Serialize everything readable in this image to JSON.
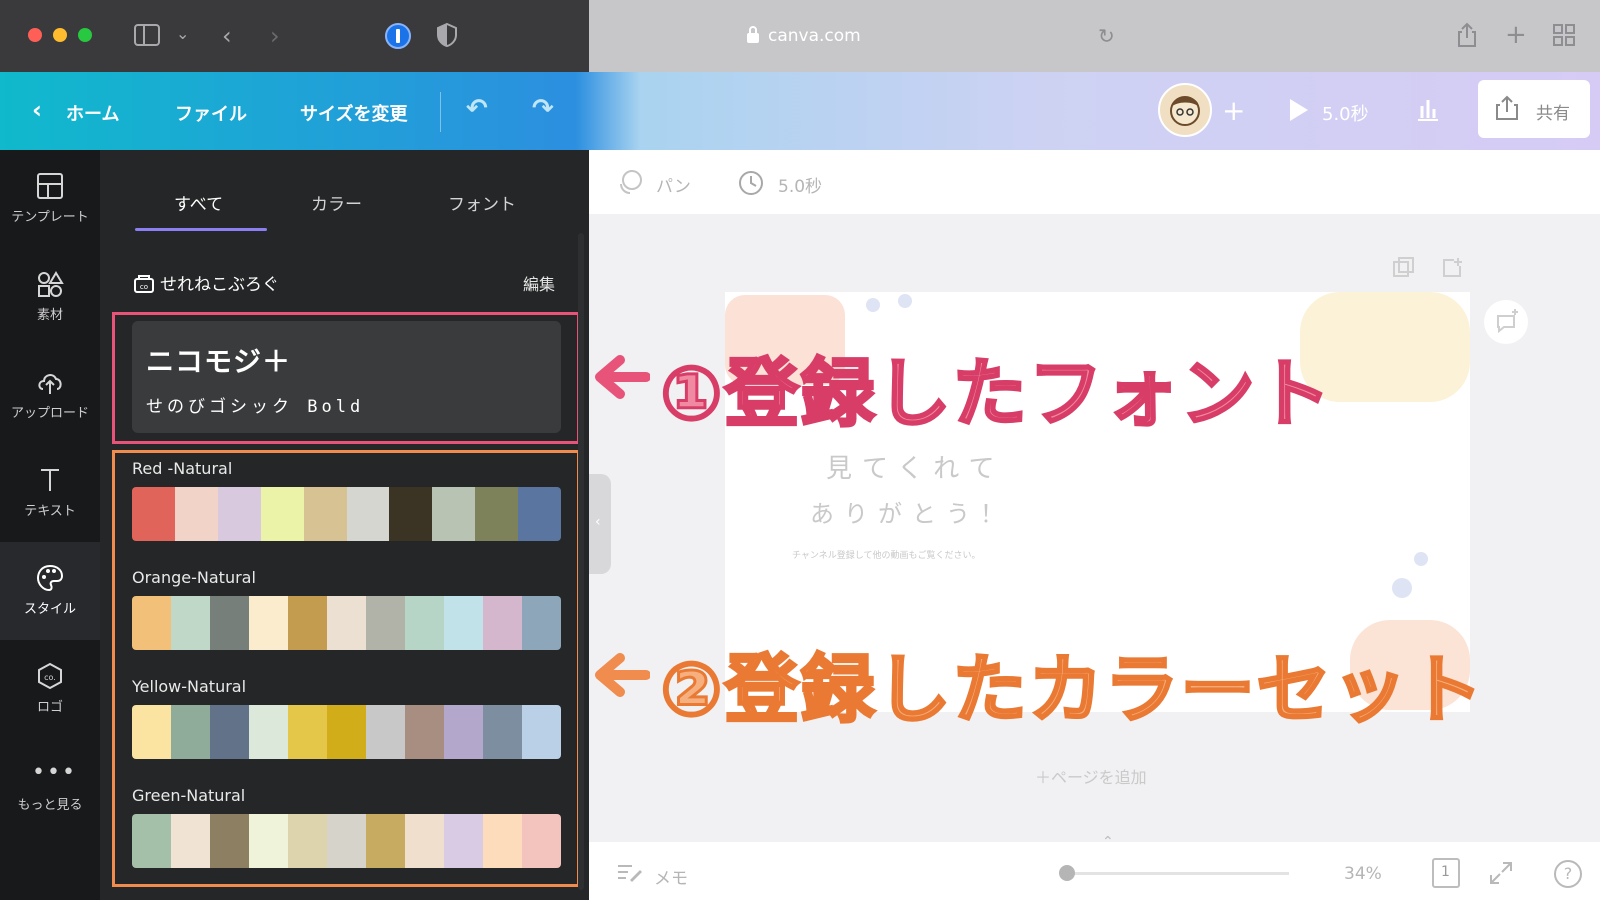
{
  "browser": {
    "url": "canva.com"
  },
  "toolbar": {
    "home": "ホーム",
    "file": "ファイル",
    "resize": "サイズを変更",
    "play_duration": "5.0秒",
    "share": "共有"
  },
  "rail": {
    "items": [
      {
        "label": "テンプレート",
        "icon": "template-icon"
      },
      {
        "label": "素材",
        "icon": "elements-icon"
      },
      {
        "label": "アップロード",
        "icon": "upload-icon"
      },
      {
        "label": "テキスト",
        "icon": "text-icon"
      },
      {
        "label": "スタイル",
        "icon": "palette-icon",
        "active": true
      },
      {
        "label": "ロゴ",
        "icon": "logo-icon"
      },
      {
        "label": "もっと見る",
        "icon": "more-icon"
      }
    ]
  },
  "panel": {
    "tabs": [
      {
        "label": "すべて",
        "active": true
      },
      {
        "label": "カラー"
      },
      {
        "label": "フォント"
      }
    ],
    "brand_kit_name": "せれねこぶろぐ",
    "edit": "編集",
    "font_heading": "ニコモジ＋",
    "font_body": "せのびゴシック Bold",
    "palettes": [
      {
        "name": "Red -Natural",
        "colors": [
          "#e0645a",
          "#f1d3c7",
          "#d8c9de",
          "#eaf3a8",
          "#d6c293",
          "#d6d6d0",
          "#3b3424",
          "#b9c3b3",
          "#7d825a",
          "#5a76a0"
        ]
      },
      {
        "name": "Orange-Natural",
        "colors": [
          "#f3c07a",
          "#bfd8c7",
          "#777f7b",
          "#fbeccd",
          "#c39c4f",
          "#ebe0d2",
          "#b1b3a9",
          "#b7d5c6",
          "#c2e2ea",
          "#d4b6cd",
          "#8ea6ba"
        ]
      },
      {
        "name": "Yellow-Natural",
        "colors": [
          "#fbe3a2",
          "#8fac9b",
          "#627289",
          "#dce8da",
          "#e4c748",
          "#d2ad1a",
          "#c8c8c8",
          "#a88e80",
          "#b3a7cc",
          "#7d8ea1",
          "#bad0e6"
        ]
      },
      {
        "name": "Green-Natural",
        "colors": [
          "#a4c0a8",
          "#f0e3d3",
          "#8d7f62",
          "#eef3da",
          "#ddd4ad",
          "#d6d3ca",
          "#c7ab60",
          "#efdfcc",
          "#d9cbe3",
          "#fcdcbb",
          "#f3c3be"
        ]
      }
    ]
  },
  "editor": {
    "animation": "パン",
    "duration": "5.0秒",
    "page_text_line1": "見てくれて",
    "page_text_line2": "ありがとう！",
    "page_text_small": "チャンネル登録して他の動画もご覧ください。",
    "add_page": "＋ページを追加",
    "notes": "メモ",
    "zoom": "34%",
    "page_number": "1"
  },
  "annotations": {
    "registered_font": "①登録したフォント",
    "registered_colorset": "②登録したカラーセット"
  },
  "colors": {
    "font_highlight": "#e85479",
    "palette_highlight": "#ef8c4e",
    "tab_accent": "#8b7ff3"
  }
}
